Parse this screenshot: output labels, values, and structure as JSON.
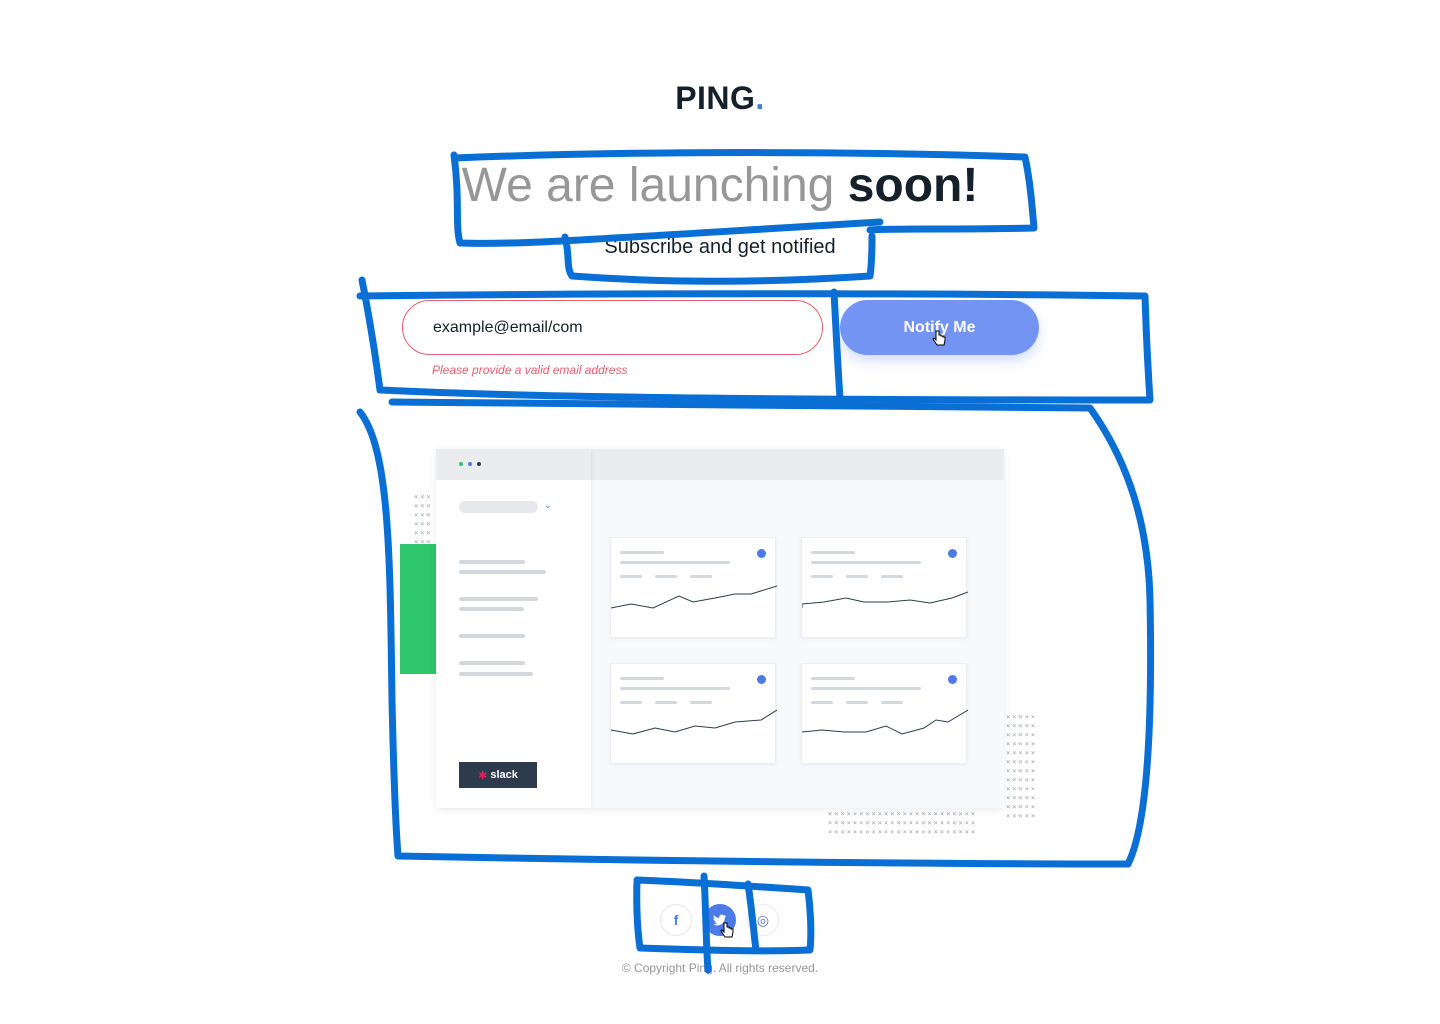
{
  "brand": {
    "name": "PING",
    "dot": "."
  },
  "hero": {
    "headline_light": "We are launching",
    "headline_bold": "soon!",
    "subtitle": "Subscribe and get notified"
  },
  "form": {
    "email_value": "example@email/com",
    "error": "Please provide a valid email address",
    "submit_label": "Notify Me"
  },
  "illustration": {
    "slack_label": "slack"
  },
  "social": [
    {
      "name": "facebook",
      "glyph": "f",
      "icon": "facebook-icon"
    },
    {
      "name": "twitter",
      "glyph": "🐦",
      "icon": "twitter-icon"
    },
    {
      "name": "instagram",
      "glyph": "◎",
      "icon": "instagram-icon"
    }
  ],
  "footer": {
    "copyright": "© Copyright Ping. All rights reserved."
  },
  "colors": {
    "accent": "#4c7ae6",
    "button": "#7394f2",
    "error": "#e2616e",
    "annotation": "#0a6fd4",
    "green": "#2dc66c"
  }
}
